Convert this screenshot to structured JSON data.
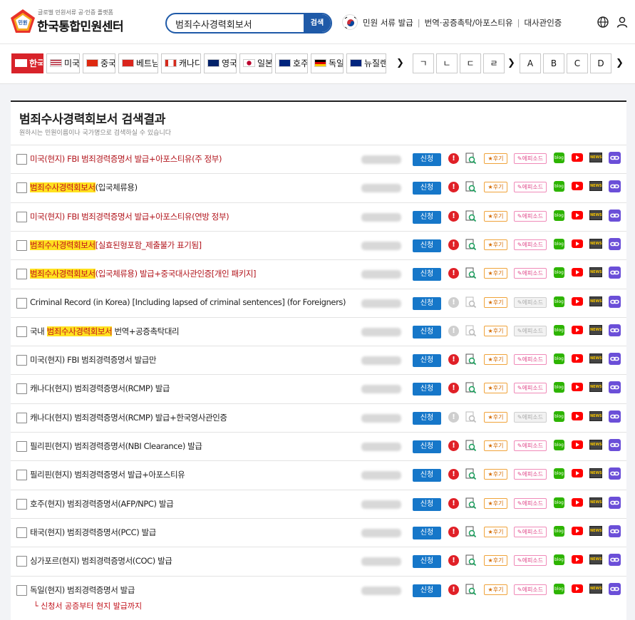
{
  "header": {
    "logo_badge": "민원",
    "logo_subtitle": "글로벌 민원서류 공·인증 플랫폼",
    "logo_title": "한국통합민원센터",
    "search_value": "범죄수사경력회보서",
    "search_button": "검색",
    "nav": [
      "민원 서류 발급",
      "번역·공증촉탁/아포스티유",
      "대사관인증"
    ]
  },
  "countries": [
    {
      "label": "한국",
      "active": true
    },
    {
      "label": "미국",
      "active": false
    },
    {
      "label": "중국",
      "active": false
    },
    {
      "label": "베트남",
      "active": false
    },
    {
      "label": "캐나다",
      "active": false
    },
    {
      "label": "영국",
      "active": false
    },
    {
      "label": "일본",
      "active": false
    },
    {
      "label": "호주",
      "active": false
    },
    {
      "label": "독일",
      "active": false
    },
    {
      "label": "뉴질랜드",
      "active": false
    }
  ],
  "nav_arrow": "❯",
  "korean_index": [
    "ㄱ",
    "ㄴ",
    "ㄷ",
    "ㄹ"
  ],
  "alpha_index": [
    "A",
    "B",
    "C",
    "D"
  ],
  "results": {
    "title": "범죄수사경력회보서 검색결과",
    "subtitle": "원하시는 민원이름이나 국가명으로 검색하실 수 있습니다",
    "apply_label": "신청",
    "warn_label": "!",
    "review_label": "★후기",
    "episode_label": "에피소드",
    "blog_label": "blog",
    "news_label": "NEWS",
    "items": [
      {
        "pre": "미국(현지) FBI 범죄경력증명서 발급+아포스티유(주 정부)",
        "hl": "",
        "post": "",
        "color": "red",
        "disabled": false
      },
      {
        "pre": "",
        "hl": "범죄수사경력회보서",
        "post": "(입국체류용)",
        "color": "black",
        "disabled": false
      },
      {
        "pre": "미국(현지) FBI 범죄경력증명서 발급+아포스티유(연방 정부)",
        "hl": "",
        "post": "",
        "color": "red",
        "disabled": false
      },
      {
        "pre": "",
        "hl": "범죄수사경력회보서",
        "post": "[실효된형포함_제출불가 표기됨]",
        "color": "red",
        "disabled": false
      },
      {
        "pre": "",
        "hl": "범죄수사경력회보서",
        "post": "(입국체류용) 발급+중국대사관인증[개인 패키지]",
        "color": "red",
        "disabled": false
      },
      {
        "pre": "Criminal Record (in Korea) [Including lapsed of criminal sentences] (for Foreigners)",
        "hl": "",
        "post": "",
        "color": "black",
        "disabled": true
      },
      {
        "pre": "국내 ",
        "hl": "범죄수사경력회보서",
        "post": " 번역+공증촉탁대리",
        "color": "black",
        "disabled": true
      },
      {
        "pre": "미국(현지) FBI 범죄경력증명서 발급만",
        "hl": "",
        "post": "",
        "color": "black",
        "disabled": false
      },
      {
        "pre": "캐나다(현지) 범죄경력증명서(RCMP) 발급",
        "hl": "",
        "post": "",
        "color": "black",
        "disabled": false
      },
      {
        "pre": "캐나다(현지) 범죄경력증명서(RCMP) 발급+한국영사관인증",
        "hl": "",
        "post": "",
        "color": "black",
        "disabled": true
      },
      {
        "pre": "필리핀(현지) 범죄경력증명서(NBI Clearance) 발급",
        "hl": "",
        "post": "",
        "color": "black",
        "disabled": false
      },
      {
        "pre": "필리핀(현지) 범죄경력증명서 발급+아포스티유",
        "hl": "",
        "post": "",
        "color": "black",
        "disabled": false
      },
      {
        "pre": "호주(현지) 범죄경력증명서(AFP/NPC) 발급",
        "hl": "",
        "post": "",
        "color": "black",
        "disabled": false
      },
      {
        "pre": "태국(현지) 범죄경력증명서(PCC) 발급",
        "hl": "",
        "post": "",
        "color": "black",
        "disabled": false
      },
      {
        "pre": "싱가포르(현지) 범죄경력증명서(COC) 발급",
        "hl": "",
        "post": "",
        "color": "black",
        "disabled": false
      },
      {
        "pre": "독일(현지) 범죄경력증명서 발급",
        "hl": "",
        "post": "",
        "color": "black",
        "disabled": false,
        "note": "└  신청서 공증부터 현지 발급까지"
      }
    ]
  }
}
